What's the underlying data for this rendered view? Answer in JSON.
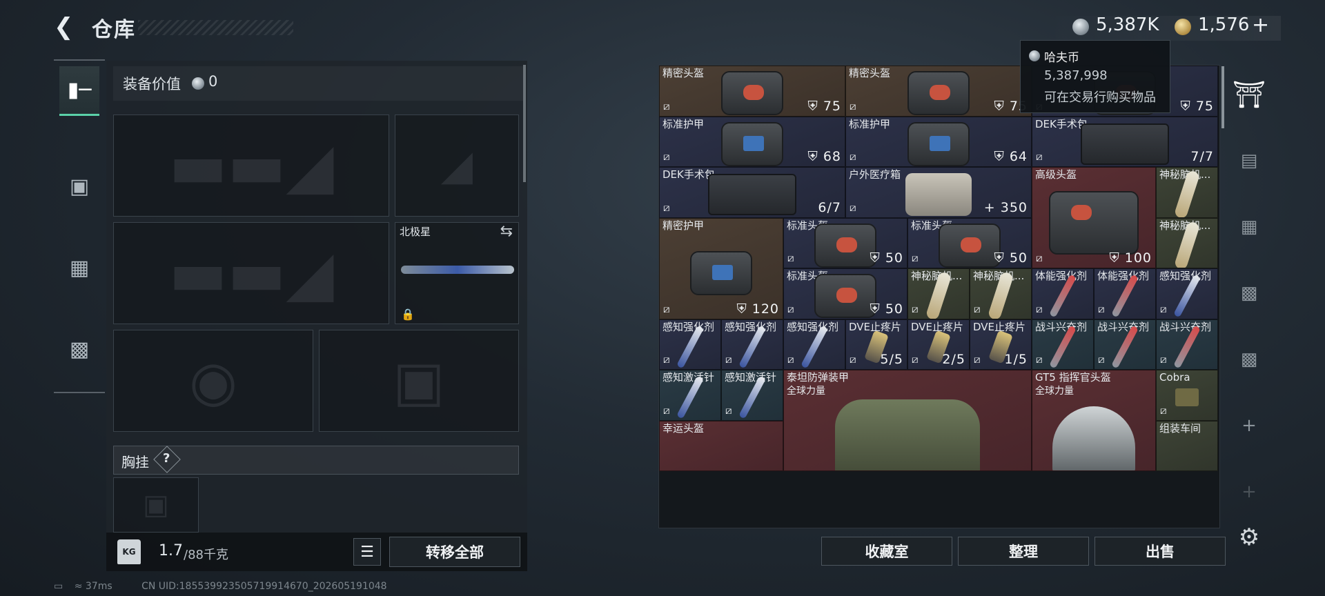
{
  "header": {
    "title": "仓库",
    "back_icon": "back-arrow-icon"
  },
  "currency": {
    "silver": "5,387K",
    "gold": "1,576",
    "add": "+"
  },
  "tooltip": {
    "name": "哈夫币",
    "amount": "5,387,998",
    "desc": "可在交易行购买物品"
  },
  "left_nav": [
    "gun-icon",
    "backpack-icon",
    "vest-icon",
    "toolbox-icon"
  ],
  "equipment": {
    "value_label": "装备价值",
    "value": "0",
    "melee_name": "北极星",
    "chest_label": "胸挂",
    "chest_help": "?",
    "weight": "1.7",
    "weight_max": "/88千克",
    "transfer_all": "转移全部"
  },
  "stash": {
    "items": [
      {
        "name": "精密头盔",
        "value": "75",
        "icon": "shield"
      },
      {
        "name": "精密头盔",
        "value": "75",
        "icon": "shield"
      },
      {
        "name": "",
        "value": "75",
        "icon": "shield"
      },
      {
        "name": "标准护甲",
        "value": "68",
        "icon": "shield"
      },
      {
        "name": "标准护甲",
        "value": "64",
        "icon": "shield"
      },
      {
        "name": "DEK手术包",
        "value": "7/7",
        "icon": ""
      },
      {
        "name": "DEK手术包",
        "value": "6/7",
        "icon": ""
      },
      {
        "name": "户外医疗箱",
        "value": "350",
        "icon": "+"
      },
      {
        "name": "高级头盔",
        "value": "100",
        "icon": "shield"
      },
      {
        "name": "神秘脑机...",
        "value": "",
        "icon": ""
      },
      {
        "name": "精密护甲",
        "value": "120",
        "icon": "shield"
      },
      {
        "name": "标准头盔",
        "value": "50",
        "icon": "shield"
      },
      {
        "name": "标准头盔",
        "value": "50",
        "icon": "shield"
      },
      {
        "name": "神秘脑机...",
        "value": "",
        "icon": ""
      },
      {
        "name": "标准头盔",
        "value": "50",
        "icon": "shield"
      },
      {
        "name": "神秘脑机...",
        "value": "",
        "icon": ""
      },
      {
        "name": "神秘脑机...",
        "value": "",
        "icon": ""
      },
      {
        "name": "体能强化剂",
        "value": "",
        "icon": ""
      },
      {
        "name": "体能强化剂",
        "value": "",
        "icon": ""
      },
      {
        "name": "感知强化剂",
        "value": "",
        "icon": ""
      },
      {
        "name": "感知强化剂",
        "value": "",
        "icon": ""
      },
      {
        "name": "感知强化剂",
        "value": "",
        "icon": ""
      },
      {
        "name": "感知强化剂",
        "value": "",
        "icon": ""
      },
      {
        "name": "DVE止疼片",
        "value": "5/5",
        "icon": ""
      },
      {
        "name": "DVE止疼片",
        "value": "2/5",
        "icon": ""
      },
      {
        "name": "DVE止疼片",
        "value": "1/5",
        "icon": ""
      },
      {
        "name": "战斗兴奋剂",
        "value": "",
        "icon": ""
      },
      {
        "name": "战斗兴奋剂",
        "value": "",
        "icon": ""
      },
      {
        "name": "战斗兴奋剂",
        "value": "",
        "icon": ""
      },
      {
        "name": "感知激活针",
        "value": "",
        "icon": ""
      },
      {
        "name": "感知激活针",
        "value": "",
        "icon": ""
      },
      {
        "name": "泰坦防弹装甲",
        "sub": "全球力量",
        "value": "",
        "icon": ""
      },
      {
        "name": "GT5 指挥官头盔",
        "sub": "全球力量",
        "value": "",
        "icon": ""
      },
      {
        "name": "Cobra",
        "value": "",
        "icon": ""
      },
      {
        "name": "幸运头盔",
        "value": "",
        "icon": ""
      },
      {
        "name": "组装车间",
        "value": "",
        "icon": ""
      }
    ],
    "buttons": {
      "collection": "收藏室",
      "sort": "整理",
      "sell": "出售"
    }
  },
  "right_bar": [
    "dome-icon",
    "iv-rack-icon",
    "iv-box-icon",
    "v-case-icon",
    "v-case-icon-2",
    "plus-icon",
    "plus-icon-dim",
    "settings-icon"
  ],
  "status": {
    "ping": "37ms",
    "uid": "CN UID:18553992350571991467​0_202605191048"
  }
}
